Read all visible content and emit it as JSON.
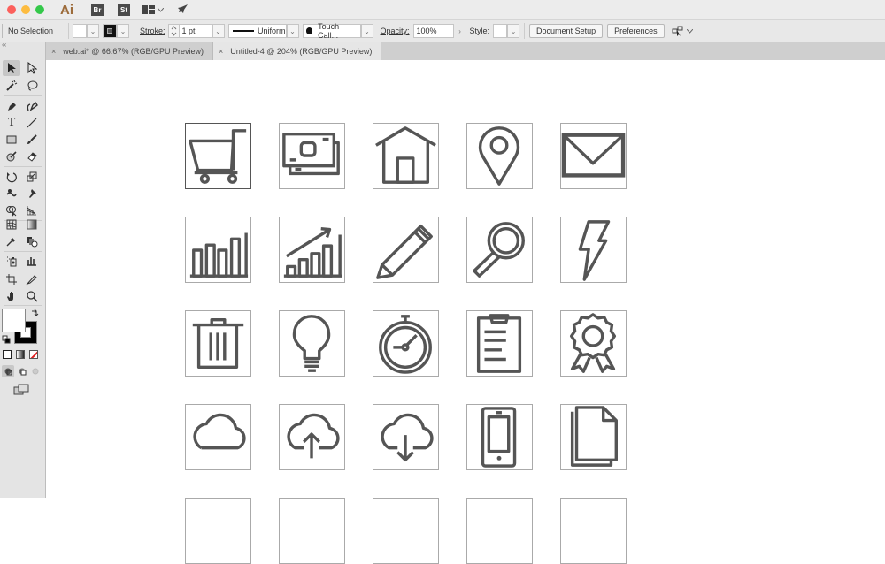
{
  "app": {
    "logo": "Ai",
    "bridge_badge": "Br",
    "stock_badge": "St",
    "traffic_colors": [
      "#fc605c",
      "#fdbc40",
      "#34c84a"
    ]
  },
  "control_bar": {
    "selection_label": "No Selection",
    "stroke_label": "Stroke:",
    "stroke_value": "1 pt",
    "profile_label": "Uniform",
    "brush_label": "Touch Call...",
    "opacity_label": "Opacity:",
    "opacity_value": "100%",
    "style_label": "Style:",
    "document_setup_label": "Document Setup",
    "preferences_label": "Preferences"
  },
  "tabs": [
    {
      "label": "web.ai* @ 66.67% (RGB/GPU Preview)",
      "close": "×",
      "active": false
    },
    {
      "label": "Untitled-4 @ 204% (RGB/GPU Preview)",
      "close": "×",
      "active": true
    }
  ],
  "tools_collapse": "‹‹",
  "icon_grid": [
    [
      "shopping-cart",
      "money",
      "home",
      "map-pin",
      "envelope"
    ],
    [
      "bar-chart",
      "growth-chart",
      "pencil",
      "magnifier",
      "lightning"
    ],
    [
      "trash",
      "lightbulb",
      "stopwatch",
      "clipboard",
      "award-ribbon"
    ],
    [
      "cloud",
      "cloud-upload",
      "cloud-download",
      "smartphone",
      "documents"
    ]
  ],
  "colors": {
    "icon_stroke": "#555555",
    "artboard_border": "#aaaaaa"
  }
}
